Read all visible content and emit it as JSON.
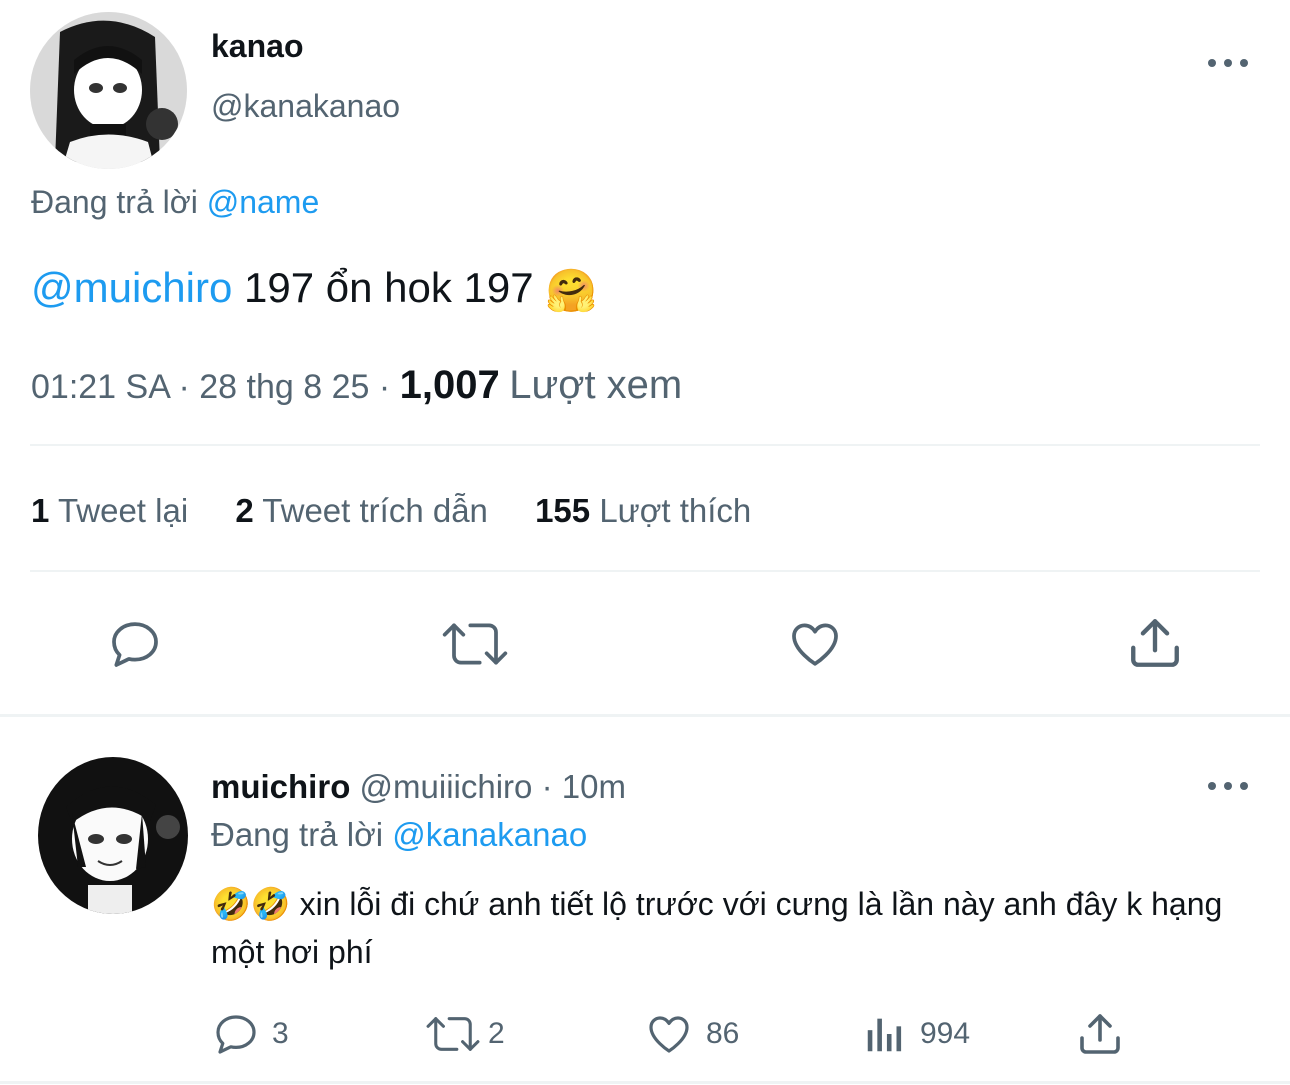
{
  "main_tweet": {
    "display_name": "kanao",
    "handle": "@kanakanao",
    "replying_prefix": "Đang trả lời",
    "replying_to": "@name",
    "mention": "@muichiro",
    "text": "197 ổn hok 197",
    "emoji": "🤗",
    "time": "01:21 SA",
    "date": "28 thg 8 25",
    "views_count": "1,007",
    "views_label": "Lượt xem",
    "stats": [
      {
        "count": "1",
        "label": "Tweet lại"
      },
      {
        "count": "2",
        "label": "Tweet trích dẫn"
      },
      {
        "count": "155",
        "label": "Lượt thích"
      }
    ],
    "actions": [
      "reply-icon",
      "retweet-icon",
      "like-icon",
      "share-icon"
    ]
  },
  "reply": {
    "display_name": "muichiro",
    "handle": "@muiiichiro",
    "time": "10m",
    "replying_prefix": "Đang trả lời",
    "replying_to": "@kanakanao",
    "emojis": "🤣🤣",
    "text": "xin lỗi đi chứ anh tiết lộ trước với cưng là lần này anh đây k hạng một hơi phí",
    "actions": {
      "replies": "3",
      "retweets": "2",
      "likes": "86",
      "views": "994"
    }
  },
  "colors": {
    "link": "#1d9bf0",
    "secondary_text": "#536471",
    "divider": "#eff3f4"
  }
}
